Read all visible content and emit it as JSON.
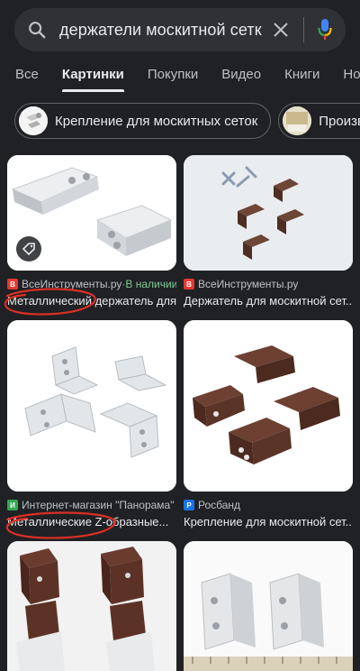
{
  "search": {
    "query": "держатели москитной сетк"
  },
  "tabs": [
    {
      "label": "Все"
    },
    {
      "label": "Картинки"
    },
    {
      "label": "Покупки"
    },
    {
      "label": "Видео"
    },
    {
      "label": "Книги"
    },
    {
      "label": "Но"
    }
  ],
  "chips": [
    {
      "label": "Крепление для москитных сеток"
    },
    {
      "label": "Произво"
    }
  ],
  "results": [
    {
      "source": "ВсеИнструменты.ру",
      "separator": " · ",
      "stock": "В наличии",
      "title": "Металлический держатель для..."
    },
    {
      "source": "ВсеИнструменты.ру",
      "title": "Держатель для москитной сет..."
    },
    {
      "source": "Интернет-магазин \"Панорама\" ·",
      "title": "Металлические Z-образные..."
    },
    {
      "source": "Росбанд",
      "title": "Крепление для москитной сет..."
    }
  ],
  "colors": {
    "background": "#202124",
    "annotation": "#d93025",
    "in_stock": "#81c995"
  }
}
